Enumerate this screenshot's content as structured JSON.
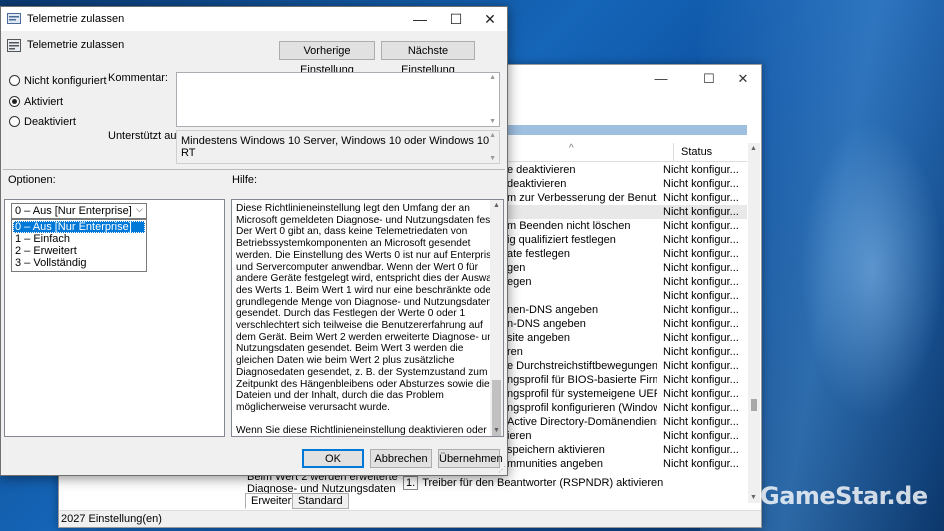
{
  "dialog": {
    "title": "Telemetrie zulassen",
    "header_title": "Telemetrie zulassen",
    "btn_previous": "Vorherige Einstellung",
    "btn_next": "Nächste Einstellung",
    "radio_not_configured": "Nicht konfiguriert",
    "radio_enabled": "Aktiviert",
    "radio_disabled": "Deaktiviert",
    "selected_radio": "Aktiviert",
    "comment_label": "Kommentar:",
    "comment_value": "",
    "supported_label": "Unterstützt auf:",
    "supported_value": "Mindestens Windows 10 Server, Windows 10 oder Windows 10 RT",
    "options_label": "Optionen:",
    "help_label": "Hilfe:",
    "combo_value": "0 – Aus [Nur Enterprise]",
    "combo_options": [
      "0 – Aus [Nur Enterprise]",
      "1 – Einfach",
      "2 – Erweitert",
      "3 – Vollständig"
    ],
    "help_paragraphs": [
      "Diese Richtlinieneinstellung legt den Umfang der an Microsoft gemeldeten Diagnose- und Nutzungsdaten fest. Der Wert 0 gibt an, dass keine Telemetriedaten von Betriebssystemkomponenten an Microsoft gesendet werden. Die Einstellung des Werts 0 ist nur auf Enterprise- und Servercomputer anwendbar. Wenn der Wert 0 für andere Geräte festgelegt wird, entspricht dies der Auswahl des Werts 1. Beim Wert 1 wird nur eine beschränkte oder grundlegende Menge von Diagnose- und Nutzungsdaten gesendet. Durch das Festlegen der Werte 0 oder 1 verschlechtert sich teilweise die Benutzererfahrung auf dem Gerät. Beim Wert 2 werden erweiterte Diagnose- und Nutzungsdaten gesendet. Beim Wert 3 werden die gleichen Daten wie beim Wert 2 plus zusätzliche Diagnosedaten gesendet, z. B. der Systemzustand zum Zeitpunkt des Hängenbleibens oder Absturzes sowie die Dateien und der Inhalt, durch die das Problem möglicherweise verursacht wurde.",
      "Wenn Sie diese Richtlinieneinstellung deaktivieren oder nicht konfigurieren, können Benutzer die Telemetriestufe in den Einstellungen konfigurieren."
    ],
    "btn_ok": "OK",
    "btn_cancel": "Abbrechen",
    "btn_apply": "Übernehmen"
  },
  "background_window": {
    "status_column": "Status",
    "rows": [
      {
        "name": "e deaktivieren",
        "status": "Nicht konfigur..."
      },
      {
        "name": "deaktivieren",
        "status": "Nicht konfigur..."
      },
      {
        "name": "m zur Verbesserung der Benutzerfreu...",
        "status": "Nicht konfigur..."
      },
      {
        "name": "",
        "status": "Nicht konfigur..."
      },
      {
        "name": "m Beenden nicht löschen",
        "status": "Nicht konfigur..."
      },
      {
        "name": "ig qualifiziert festlegen",
        "status": "Nicht konfigur..."
      },
      {
        "name": "ate festlegen",
        "status": "Nicht konfigur..."
      },
      {
        "name": "gen",
        "status": "Nicht konfigur..."
      },
      {
        "name": "egen",
        "status": "Nicht konfigur..."
      },
      {
        "name": "",
        "status": "Nicht konfigur..."
      },
      {
        "name": "nen-DNS angeben",
        "status": "Nicht konfigur..."
      },
      {
        "name": "n-DNS angeben",
        "status": "Nicht konfigur..."
      },
      {
        "name": "site angeben",
        "status": "Nicht konfigur..."
      },
      {
        "name": "ren",
        "status": "Nicht konfigur..."
      },
      {
        "name": "e Durchstreichstiftbewegungen deak...",
        "status": "Nicht konfigur..."
      },
      {
        "name": "ngsprofil für BIOS-basierte Firmware...",
        "status": "Nicht konfigur..."
      },
      {
        "name": "ngsprofil für systemeigene UEFI-Fir...",
        "status": "Nicht konfigur..."
      },
      {
        "name": "ngsprofil konfigurieren (Windows Vi...",
        "status": "Nicht konfigur..."
      },
      {
        "name": "Active Directory-Domänendiensten a...",
        "status": "Nicht konfigur..."
      },
      {
        "name": "ieren",
        "status": "Nicht konfigur..."
      },
      {
        "name": "speichern aktivieren",
        "status": "Nicht konfigur..."
      },
      {
        "name": "mmunities angeben",
        "status": "Nicht konfigur..."
      }
    ],
    "bottom_text_1": "Beim Wert 2 werden erweiterte",
    "bottom_text_2": "Diagnose- und Nutzungsdaten",
    "bottom_text_3": "Treiber für den Beantworter (RSPNDR) aktivieren",
    "tab_extended": "Erweitert",
    "tab_standard": "Standard",
    "status_bar": "2027 Einstellung(en)"
  },
  "watermark": "GameStar.de"
}
